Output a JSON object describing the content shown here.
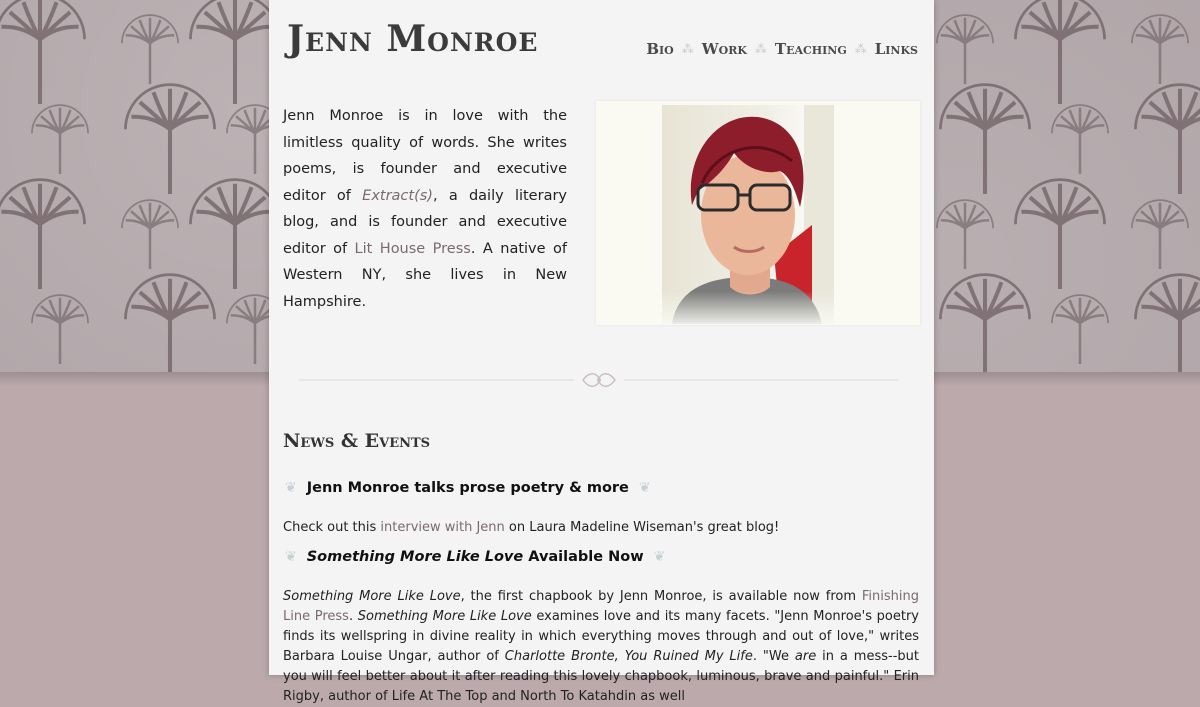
{
  "site": {
    "title": "Jenn Monroe"
  },
  "nav": {
    "items": [
      "Bio",
      "Work",
      "Teaching",
      "Links"
    ],
    "separator": "⁂"
  },
  "intro": {
    "t1": "Jenn Monroe is in love with the limitless quality of words. She writes poems, is founder and executive editor of ",
    "link1": "Extract(s)",
    "t2": ", a daily literary blog, and is founder and executive editor of ",
    "link2": "Lit House Press",
    "t3": ". A native of Western NY, she lives in New Hampshire."
  },
  "photo": {
    "alt": "portrait"
  },
  "news": {
    "heading": "News & Events",
    "posts": [
      {
        "title": "Jenn Monroe talks prose poetry & more",
        "b1": "Check out this ",
        "link": "interview with Jenn",
        "b2": " on Laura Madeline Wiseman's great blog!"
      },
      {
        "title_em": "Something More Like Love",
        "title_rest": " Available Now",
        "s1_em": "Something More Like Love",
        "s1": ", the first chapbook by Jenn Monroe, is available now from ",
        "link": "Finishing Line Press",
        "s2": ". ",
        "s2_em": "Something More Like Love",
        "s3": " examines love and its many facets. \"Jenn Monroe's poetry finds its wellspring in divine reality in which everything moves through and out of love,\" writes Barbara Louise Ungar, author of ",
        "s3_em": "Charlotte Bronte, You Ruined My Life",
        "s4": ". \"We ",
        "s4_em": "are",
        "s5": " in a mess--but you will feel better about it after reading this lovely chapbook, luminous, brave and",
        "s5_tail": " painful.\" Erin Rigby, author of Life At The Top and North To Katahdin as well"
      }
    ]
  },
  "colors": {
    "link": "#7a6a6d",
    "page_bg": "#f4f4f4",
    "outer_bg": "#ada1a4"
  }
}
